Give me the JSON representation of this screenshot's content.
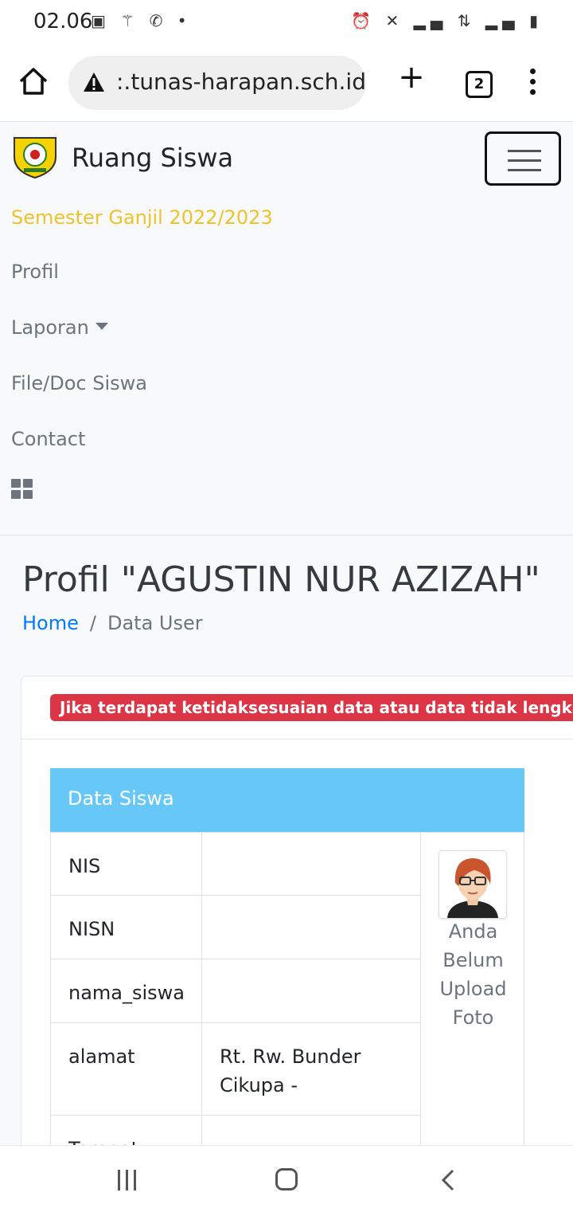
{
  "status_bar": {
    "time": "02.06",
    "left_icons": [
      "image-icon",
      "magic-icon",
      "call-icon",
      "dot-icon"
    ],
    "right_icons": [
      "alarm-icon",
      "mute-icon",
      "signal-icon",
      "4g-icon",
      "signal-icon",
      "battery-icon"
    ]
  },
  "browser": {
    "url": ":.tunas-harapan.sch.id",
    "tab_count": "2",
    "plus_label": "+"
  },
  "navbar": {
    "brand": "Ruang Siswa",
    "semester": "Semester Ganjil 2022/2023",
    "links": [
      "Profil",
      "Laporan",
      "File/Doc Siswa",
      "Contact"
    ]
  },
  "page": {
    "title": "Profil \"AGUSTIN NUR AZIZAH\"",
    "breadcrumb_home": "Home",
    "breadcrumb_sep": "/",
    "breadcrumb_current": "Data User"
  },
  "card": {
    "alert": "Jika terdapat ketidaksesuaian data atau data tidak lengkap segera hubungi",
    "table_title": "Data Siswa",
    "rows": [
      {
        "label": "NIS",
        "value": ""
      },
      {
        "label": "NISN",
        "value": ""
      },
      {
        "label": "nama_siswa",
        "value": ""
      },
      {
        "label": "alamat",
        "value": "Rt. Rw. Bunder Cikupa -"
      },
      {
        "label": "Tempat",
        "value": ""
      }
    ],
    "photo_text": "Anda Belum Upload Foto"
  },
  "colors": {
    "accent": "#007bff",
    "semester": "#f0c22a",
    "alert": "#dc3545",
    "table_header": "#67c8f8"
  }
}
